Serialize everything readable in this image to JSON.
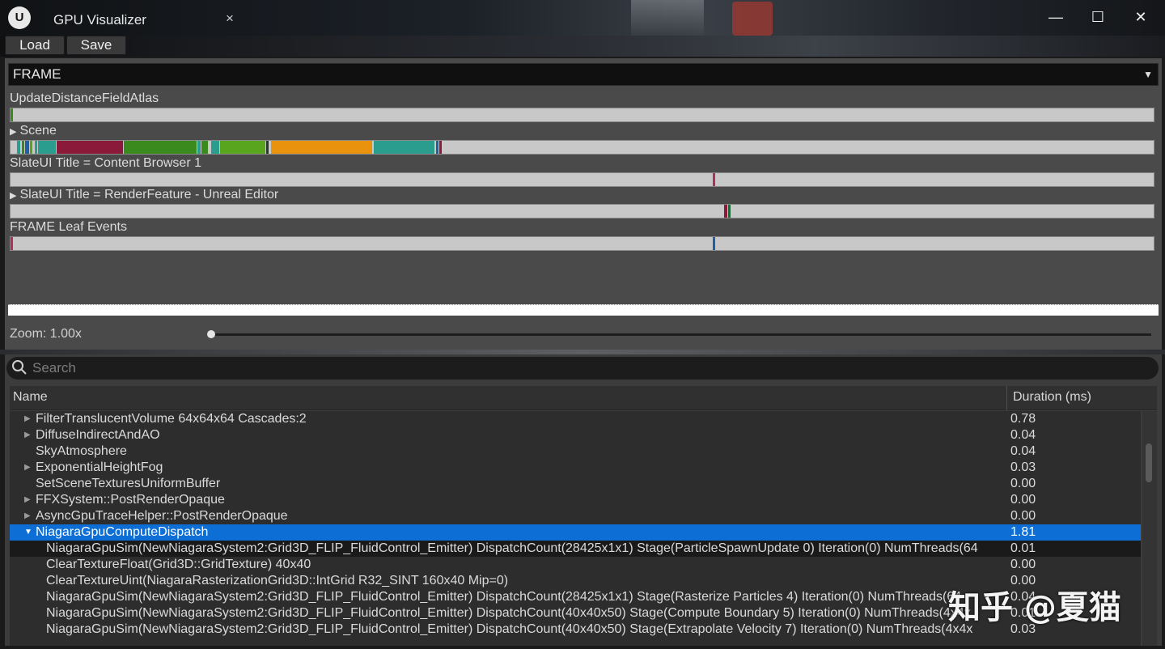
{
  "window": {
    "title": "GPU Visualizer",
    "logo": "U",
    "tab_close": "×",
    "minimize": "—",
    "maximize": "☐",
    "close": "✕"
  },
  "toolbar": {
    "load_label": "Load",
    "save_label": "Save"
  },
  "frame_select": {
    "value": "FRAME",
    "arrow": "▼"
  },
  "timeline": {
    "rows": [
      {
        "label": "UpdateDistanceFieldAtlas",
        "expandable": false
      },
      {
        "label": "Scene",
        "expandable": true
      },
      {
        "label": "SlateUI Title = Content Browser 1",
        "expandable": false
      },
      {
        "label": "SlateUI Title = RenderFeature - Unreal Editor",
        "expandable": true
      },
      {
        "label": "FRAME Leaf Events",
        "expandable": false
      }
    ],
    "colors": {
      "teal": "#2a9d8f",
      "crimson": "#8b1a3a",
      "green": "#3a8a1e",
      "lime": "#5aa51e",
      "orange": "#e8920e",
      "blue": "#1f5fa8",
      "bar_bg": "#c8c8c8"
    }
  },
  "zoom": {
    "label": "Zoom: 1.00x",
    "value": 1.0
  },
  "search": {
    "placeholder": "Search",
    "value": ""
  },
  "table": {
    "columns": [
      "Name",
      "Duration (ms)"
    ],
    "rows": [
      {
        "name": "FilterTranslucentVolume 64x64x64 Cascades:2",
        "duration": "0.78",
        "expandable": true,
        "level": 0
      },
      {
        "name": "DiffuseIndirectAndAO",
        "duration": "0.04",
        "expandable": true,
        "level": 0
      },
      {
        "name": "SkyAtmosphere",
        "duration": "0.04",
        "expandable": false,
        "level": 0
      },
      {
        "name": "ExponentialHeightFog",
        "duration": "0.03",
        "expandable": true,
        "level": 0
      },
      {
        "name": "SetSceneTexturesUniformBuffer",
        "duration": "0.00",
        "expandable": false,
        "level": 0
      },
      {
        "name": "FFXSystem::PostRenderOpaque",
        "duration": "0.00",
        "expandable": true,
        "level": 0
      },
      {
        "name": "AsyncGpuTraceHelper::PostRenderOpaque",
        "duration": "0.00",
        "expandable": true,
        "level": 0
      },
      {
        "name": "NiagaraGpuComputeDispatch",
        "duration": "1.81",
        "expandable": true,
        "expanded": true,
        "level": 0,
        "state": "selected"
      },
      {
        "name": "NiagaraGpuSim(NewNiagaraSystem2:Grid3D_FLIP_FluidControl_Emitter) DispatchCount(28425x1x1) Stage(ParticleSpawnUpdate 0) Iteration(0) NumThreads(64",
        "duration": "0.01",
        "expandable": false,
        "level": 1,
        "state": "hover"
      },
      {
        "name": "ClearTextureFloat(Grid3D::GridTexture) 40x40",
        "duration": "0.00",
        "expandable": false,
        "level": 1
      },
      {
        "name": "ClearTextureUint(NiagaraRasterizationGrid3D::IntGrid R32_SINT 160x40 Mip=0)",
        "duration": "0.00",
        "expandable": false,
        "level": 1
      },
      {
        "name": "NiagaraGpuSim(NewNiagaraSystem2:Grid3D_FLIP_FluidControl_Emitter) DispatchCount(28425x1x1) Stage(Rasterize Particles 4) Iteration(0) NumThreads(64",
        "duration": "0.04",
        "expandable": false,
        "level": 1
      },
      {
        "name": "NiagaraGpuSim(NewNiagaraSystem2:Grid3D_FLIP_FluidControl_Emitter) DispatchCount(40x40x50) Stage(Compute Boundary 5) Iteration(0) NumThreads(4x4x",
        "duration": "0.01",
        "expandable": false,
        "level": 1
      },
      {
        "name": "NiagaraGpuSim(NewNiagaraSystem2:Grid3D_FLIP_FluidControl_Emitter) DispatchCount(40x40x50) Stage(Extrapolate Velocity 7) Iteration(0) NumThreads(4x4x",
        "duration": "0.03",
        "expandable": false,
        "level": 1
      }
    ]
  },
  "watermark": "知乎 @夏猫"
}
